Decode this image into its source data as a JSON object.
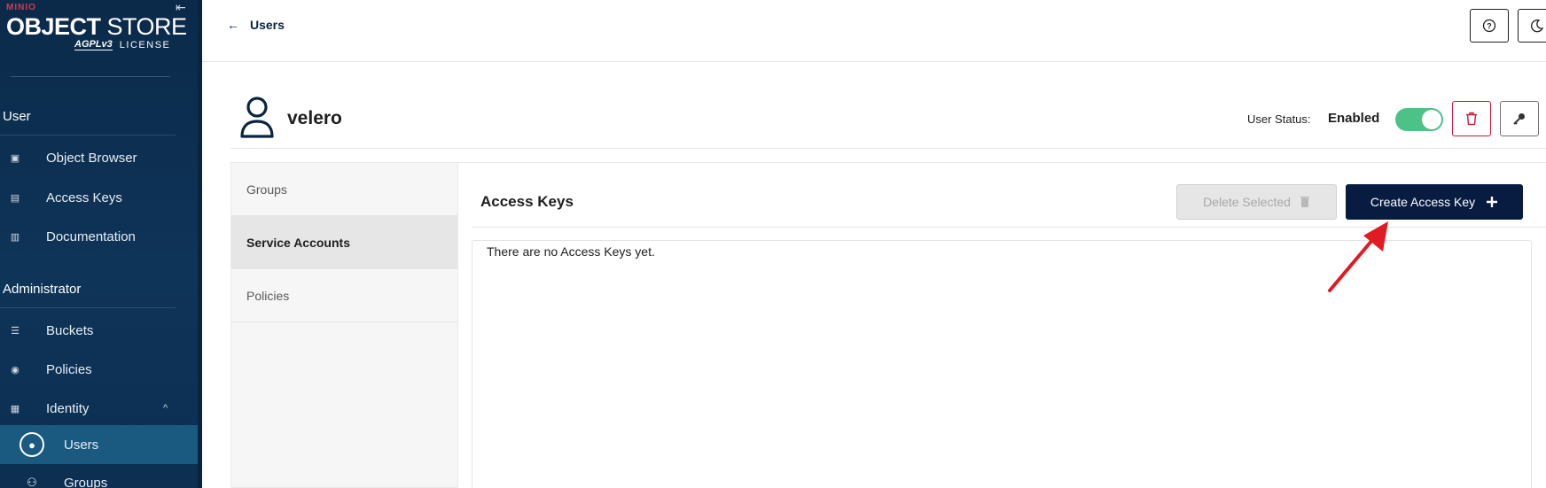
{
  "sidebar": {
    "brand_top": "MINIO",
    "brand_title_bold": "OBJECT",
    "brand_title_rest": " STORE",
    "brand_badge": "AGPLv3",
    "brand_license": "LICENSE",
    "section_user": "User",
    "section_admin": "Administrator",
    "items": [
      {
        "label": "Object Browser",
        "icon": "object-browser-icon"
      },
      {
        "label": "Access Keys",
        "icon": "access-keys-icon"
      },
      {
        "label": "Documentation",
        "icon": "documentation-icon"
      },
      {
        "label": "Buckets",
        "icon": "buckets-icon"
      },
      {
        "label": "Policies",
        "icon": "policies-icon"
      },
      {
        "label": "Identity",
        "icon": "identity-icon"
      },
      {
        "label": "Users",
        "icon": "users-icon"
      },
      {
        "label": "Groups",
        "icon": "groups-icon"
      }
    ]
  },
  "header": {
    "back_label": "Users"
  },
  "user": {
    "name": "velero",
    "status_label": "User Status:",
    "status_value": "Enabled",
    "enabled": true
  },
  "tabs": [
    {
      "label": "Groups",
      "active": false
    },
    {
      "label": "Service Accounts",
      "active": true
    },
    {
      "label": "Policies",
      "active": false
    }
  ],
  "content": {
    "title": "Access Keys",
    "delete_selected_label": "Delete Selected",
    "create_label": "Create Access Key",
    "empty_message": "There are no Access Keys yet."
  },
  "colors": {
    "sidebar_bg": "#0e3458",
    "primary_button": "#081c42",
    "toggle_on": "#4cc289",
    "danger": "#c51b3b",
    "annotation_arrow": "#e01b24"
  }
}
